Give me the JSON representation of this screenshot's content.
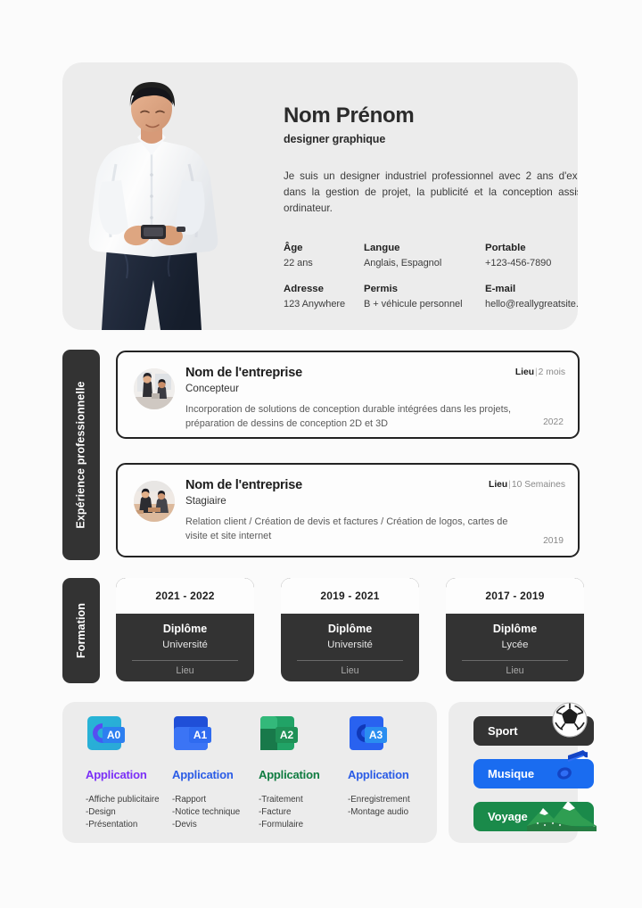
{
  "header": {
    "name": "Nom Prénom",
    "role": "designer graphique",
    "bio": "Je suis un designer industriel professionnel avec 2 ans d'expérience dans la gestion de projet, la publicité et la conception assistée par ordinateur.",
    "photo_alt": "portrait-photo",
    "info": [
      {
        "label": "Âge",
        "value": "22  ans"
      },
      {
        "label": "Langue",
        "value": "Anglais, Espagnol"
      },
      {
        "label": "Portable",
        "value": "+123-456-7890"
      },
      {
        "label": "Adresse",
        "value": "123 Anywhere"
      },
      {
        "label": "Permis",
        "value": "B + véhicule personnel"
      },
      {
        "label": "E-mail",
        "value": "hello@reallygreatsite.com"
      }
    ]
  },
  "sections": {
    "experience_label": "Expérience professionnelle",
    "formation_label": "Formation"
  },
  "experience": [
    {
      "company": "Nom de l'entreprise",
      "role": "Concepteur",
      "description": "Incorporation de solutions de conception durable intégrées dans les projets, préparation de dessins de conception 2D et 3D",
      "place": "Lieu",
      "separator": "|",
      "duration": "2 mois",
      "year": "2022",
      "avatar_alt": "company-photo"
    },
    {
      "company": "Nom de l'entreprise",
      "role": "Stagiaire",
      "description": "Relation client / Création de devis et factures / Création de logos, cartes de visite et site internet",
      "place": "Lieu",
      "separator": "|",
      "duration": "10 Semaines",
      "year": "2019",
      "avatar_alt": "company-photo"
    }
  ],
  "formation": [
    {
      "years": "2021 - 2022",
      "degree": "Diplôme",
      "school": "Université",
      "place": "Lieu"
    },
    {
      "years": "2019 - 2021",
      "degree": "Diplôme",
      "school": "Université",
      "place": "Lieu"
    },
    {
      "years": "2017 - 2019",
      "degree": "Diplôme",
      "school": "Lycée",
      "place": "Lieu"
    }
  ],
  "applications": [
    {
      "badge": "A0",
      "name": "Application",
      "color": "#7b2ff7",
      "icon": "app-a0-icon",
      "items": [
        "-Affiche publicitaire",
        "-Design",
        "-Présentation"
      ]
    },
    {
      "badge": "A1",
      "name": "Application",
      "color": "#2b5ce6",
      "icon": "app-a1-icon",
      "items": [
        "-Rapport",
        "-Notice technique",
        "-Devis"
      ]
    },
    {
      "badge": "A2",
      "name": "Application",
      "color": "#107c41",
      "icon": "app-a2-icon",
      "items": [
        "-Traitement",
        "-Facture",
        "-Formulaire"
      ]
    },
    {
      "badge": "A3",
      "name": "Application",
      "color": "#2b5ce6",
      "icon": "app-a3-icon",
      "items": [
        "-Enregistrement",
        "-Montage audio"
      ]
    }
  ],
  "hobbies": [
    {
      "label": "Sport",
      "color": "#333333",
      "icon": "soccer-ball-icon"
    },
    {
      "label": "Musique",
      "color": "#1a6cf0",
      "icon": "music-note-icon"
    },
    {
      "label": "Voyage",
      "color": "#1a8a4a",
      "icon": "mountain-icon"
    }
  ]
}
